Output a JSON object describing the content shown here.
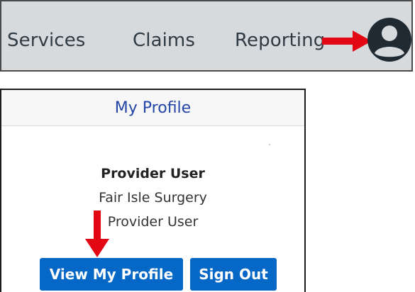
{
  "nav": {
    "items": [
      {
        "label": "Services"
      },
      {
        "label": "Claims"
      },
      {
        "label": "Reporting"
      }
    ],
    "profile_icon": "user-circle-icon",
    "arrow_icon": "right-arrow-icon"
  },
  "profile_panel": {
    "title": "My Profile",
    "user_name": "Provider User",
    "organization": "Fair Isle Surgery",
    "role": "Provider User",
    "view_profile_label": "View My Profile",
    "sign_out_label": "Sign Out",
    "arrow_icon": "down-arrow-icon"
  },
  "colors": {
    "nav_background": "#d7dadd",
    "header_text": "#2245a6",
    "button_primary": "#0568c6",
    "annotation_arrow": "#e30613",
    "profile_icon": "#1f2a33"
  }
}
